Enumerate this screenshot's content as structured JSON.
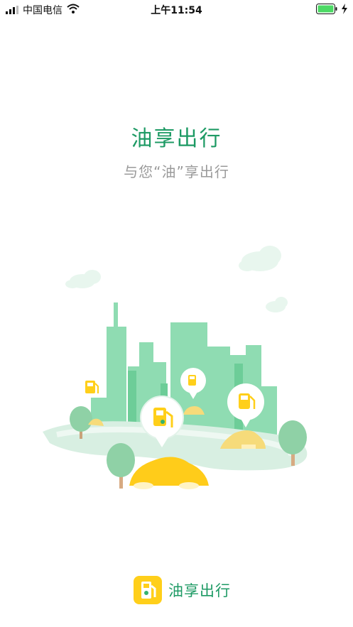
{
  "status_bar": {
    "carrier": "中国电信",
    "time": "上午11:54"
  },
  "splash": {
    "title": "油享出行",
    "subtitle": "与您“油”享出行"
  },
  "footer": {
    "brand_name": "油享出行"
  },
  "colors": {
    "brand_green": "#1d9a64",
    "subtitle_gray": "#9a9a9a",
    "accent_yellow": "#ffcf1a",
    "building_green": "#8fdcb2"
  },
  "icons": [
    "signal-icon",
    "wifi-icon",
    "battery-icon",
    "charging-icon",
    "fuel-pump-icon"
  ]
}
